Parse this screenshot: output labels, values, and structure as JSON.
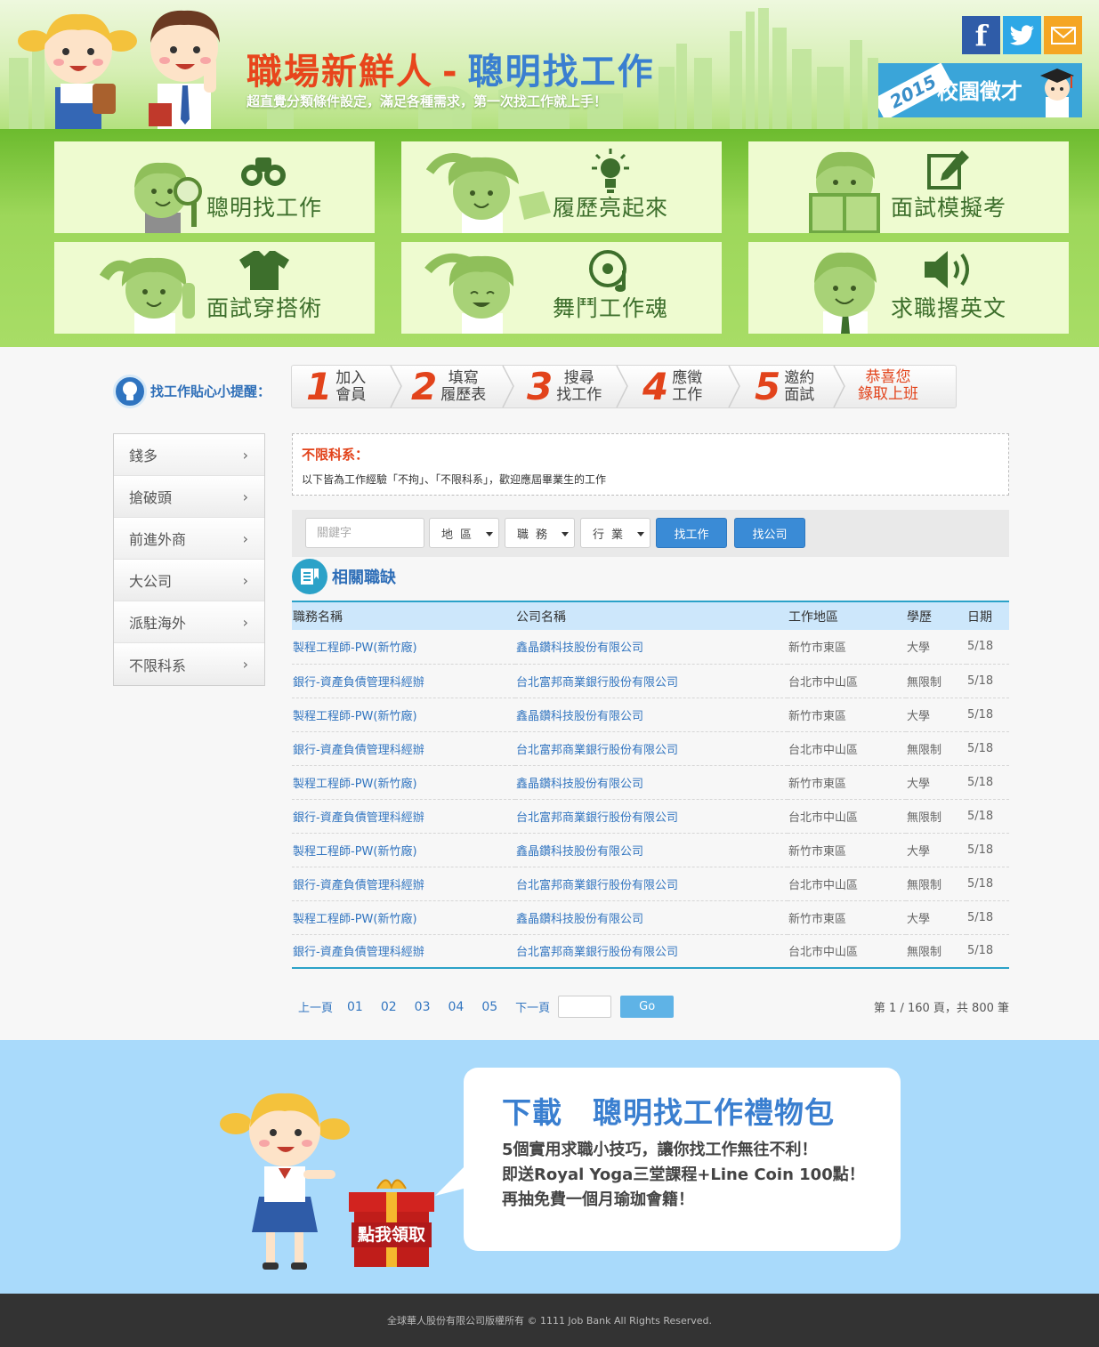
{
  "header": {
    "title_part1": "職場新鮮人",
    "title_dash": "-",
    "title_part2": "聰明找工作",
    "subtitle": "超直覺分類條件設定，滿足各種需求，第一次找工作就上手！",
    "social": [
      {
        "name": "facebook",
        "icon": "facebook-icon",
        "glyph": "f"
      },
      {
        "name": "twitter",
        "icon": "twitter-icon"
      },
      {
        "name": "email",
        "icon": "mail-icon"
      }
    ],
    "campus": {
      "year": "2015",
      "label": "校園徵才"
    }
  },
  "menu": [
    {
      "label": "聰明找工作",
      "icon": "binoculars-icon"
    },
    {
      "label": "履歷亮起來",
      "icon": "lightbulb-icon"
    },
    {
      "label": "面試模擬考",
      "icon": "edit-icon"
    },
    {
      "label": "面試穿搭術",
      "icon": "tshirt-icon"
    },
    {
      "label": "舞鬥工作魂",
      "icon": "music-disc-icon"
    },
    {
      "label": "求職撂英文",
      "icon": "speaker-icon"
    }
  ],
  "tips": {
    "label": "找工作貼心小提醒：",
    "steps": [
      {
        "num": "1",
        "line1": "加入",
        "line2": "會員"
      },
      {
        "num": "2",
        "line1": "填寫",
        "line2": "履歷表"
      },
      {
        "num": "3",
        "line1": "搜尋",
        "line2": "找工作"
      },
      {
        "num": "4",
        "line1": "應徵",
        "line2": "工作"
      },
      {
        "num": "5",
        "line1": "邀約",
        "line2": "面試"
      }
    ],
    "final_line1": "恭喜您",
    "final_line2": "錄取上班"
  },
  "sidebar": {
    "items": [
      {
        "label": "錢多"
      },
      {
        "label": "搶破頭"
      },
      {
        "label": "前進外商"
      },
      {
        "label": "大公司"
      },
      {
        "label": "派駐海外"
      },
      {
        "label": "不限科系"
      }
    ],
    "chevron": "›"
  },
  "notice": {
    "title": "不限科系：",
    "desc": "以下皆為工作經驗「不拘」、「不限科系」，歡迎應屆畢業生的工作"
  },
  "search": {
    "keyword_placeholder": "關鍵字",
    "keyword_value": "",
    "region": "地區",
    "job": "職務",
    "industry": "行業",
    "find_job": "找工作",
    "find_company": "找公司"
  },
  "jobs": {
    "title": "相關職缺",
    "columns": [
      "職務名稱",
      "公司名稱",
      "工作地區",
      "學歷",
      "日期"
    ],
    "rows": [
      [
        "製程工程師-PW(新竹廠)",
        "鑫晶鑽科技股份有限公司",
        "新竹市東區",
        "大學",
        "5/18"
      ],
      [
        "銀行-資產負債管理科經辦",
        "台北富邦商業銀行股份有限公司",
        "台北市中山區",
        "無限制",
        "5/18"
      ],
      [
        "製程工程師-PW(新竹廠)",
        "鑫晶鑽科技股份有限公司",
        "新竹市東區",
        "大學",
        "5/18"
      ],
      [
        "銀行-資產負債管理科經辦",
        "台北富邦商業銀行股份有限公司",
        "台北市中山區",
        "無限制",
        "5/18"
      ],
      [
        "製程工程師-PW(新竹廠)",
        "鑫晶鑽科技股份有限公司",
        "新竹市東區",
        "大學",
        "5/18"
      ],
      [
        "銀行-資產負債管理科經辦",
        "台北富邦商業銀行股份有限公司",
        "台北市中山區",
        "無限制",
        "5/18"
      ],
      [
        "製程工程師-PW(新竹廠)",
        "鑫晶鑽科技股份有限公司",
        "新竹市東區",
        "大學",
        "5/18"
      ],
      [
        "銀行-資產負債管理科經辦",
        "台北富邦商業銀行股份有限公司",
        "台北市中山區",
        "無限制",
        "5/18"
      ],
      [
        "製程工程師-PW(新竹廠)",
        "鑫晶鑽科技股份有限公司",
        "新竹市東區",
        "大學",
        "5/18"
      ],
      [
        "銀行-資產負債管理科經辦",
        "台北富邦商業銀行股份有限公司",
        "台北市中山區",
        "無限制",
        "5/18"
      ]
    ]
  },
  "pager": {
    "prev": "上一頁",
    "pages": [
      "01",
      "02",
      "03",
      "04",
      "05"
    ],
    "next": "下一頁",
    "go": "Go",
    "info": "第 1 / 160 頁，共 800 筆"
  },
  "promo": {
    "title_a": "下載",
    "title_b": "聰明找工作禮物包",
    "line1": "5個實用求職小技巧，讓你找工作無往不利！",
    "line2": "即送Royal Yoga三堂課程+Line Coin 100點！",
    "line3": "再抽免費一個月瑜珈會籍！",
    "gift_label": "點我領取"
  },
  "footer": {
    "text": "全球華人股份有限公司版權所有 ©  1111 Job Bank All Rights Reserved."
  },
  "colors": {
    "accent_red": "#e8451c",
    "accent_blue": "#3a7fd0",
    "menu_green": "#9dd75a",
    "table_accent": "#2ba2c8",
    "promo_bg": "#a9dafb"
  }
}
